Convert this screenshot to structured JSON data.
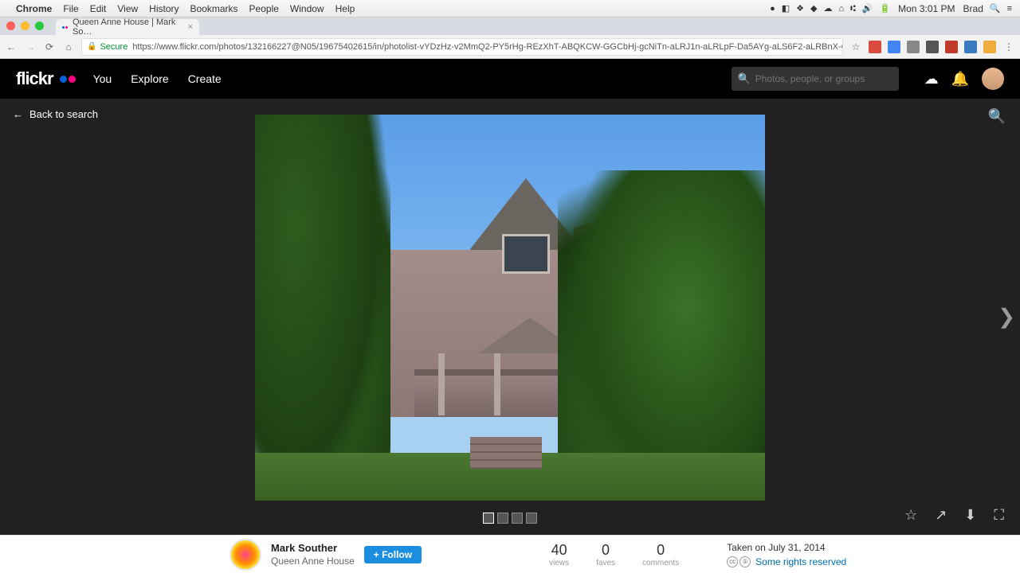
{
  "mac_menu": {
    "app": "Chrome",
    "items": [
      "File",
      "Edit",
      "View",
      "History",
      "Bookmarks",
      "People",
      "Window",
      "Help"
    ],
    "clock": "Mon 3:01 PM",
    "user": "Brad"
  },
  "browser": {
    "tab_title": "Queen Anne House | Mark So…",
    "secure_label": "Secure",
    "url": "https://www.flickr.com/photos/132166227@N05/19675402615/in/photolist-vYDzHz-v2MmQ2-PY5rHg-REzXhT-ABQKCW-GGCbHj-gcNiTn-aLRJ1n-aLRLpF-Da5AYg-aLS6F2-aLRBnX-QAqTbS-gcNofD-23tmL44-eBnseL-…"
  },
  "header": {
    "logo": "flickr",
    "nav": [
      "You",
      "Explore",
      "Create"
    ],
    "search_placeholder": "Photos, people, or groups"
  },
  "viewer": {
    "back_label": "Back to search"
  },
  "info": {
    "author": "Mark Souther",
    "title": "Queen Anne House",
    "follow": "+ Follow",
    "stats": {
      "views": {
        "value": "40",
        "label": "views"
      },
      "faves": {
        "value": "0",
        "label": "faves"
      },
      "comments": {
        "value": "0",
        "label": "comments"
      }
    },
    "date": "Taken on July 31, 2014",
    "rights": "Some rights reserved"
  }
}
